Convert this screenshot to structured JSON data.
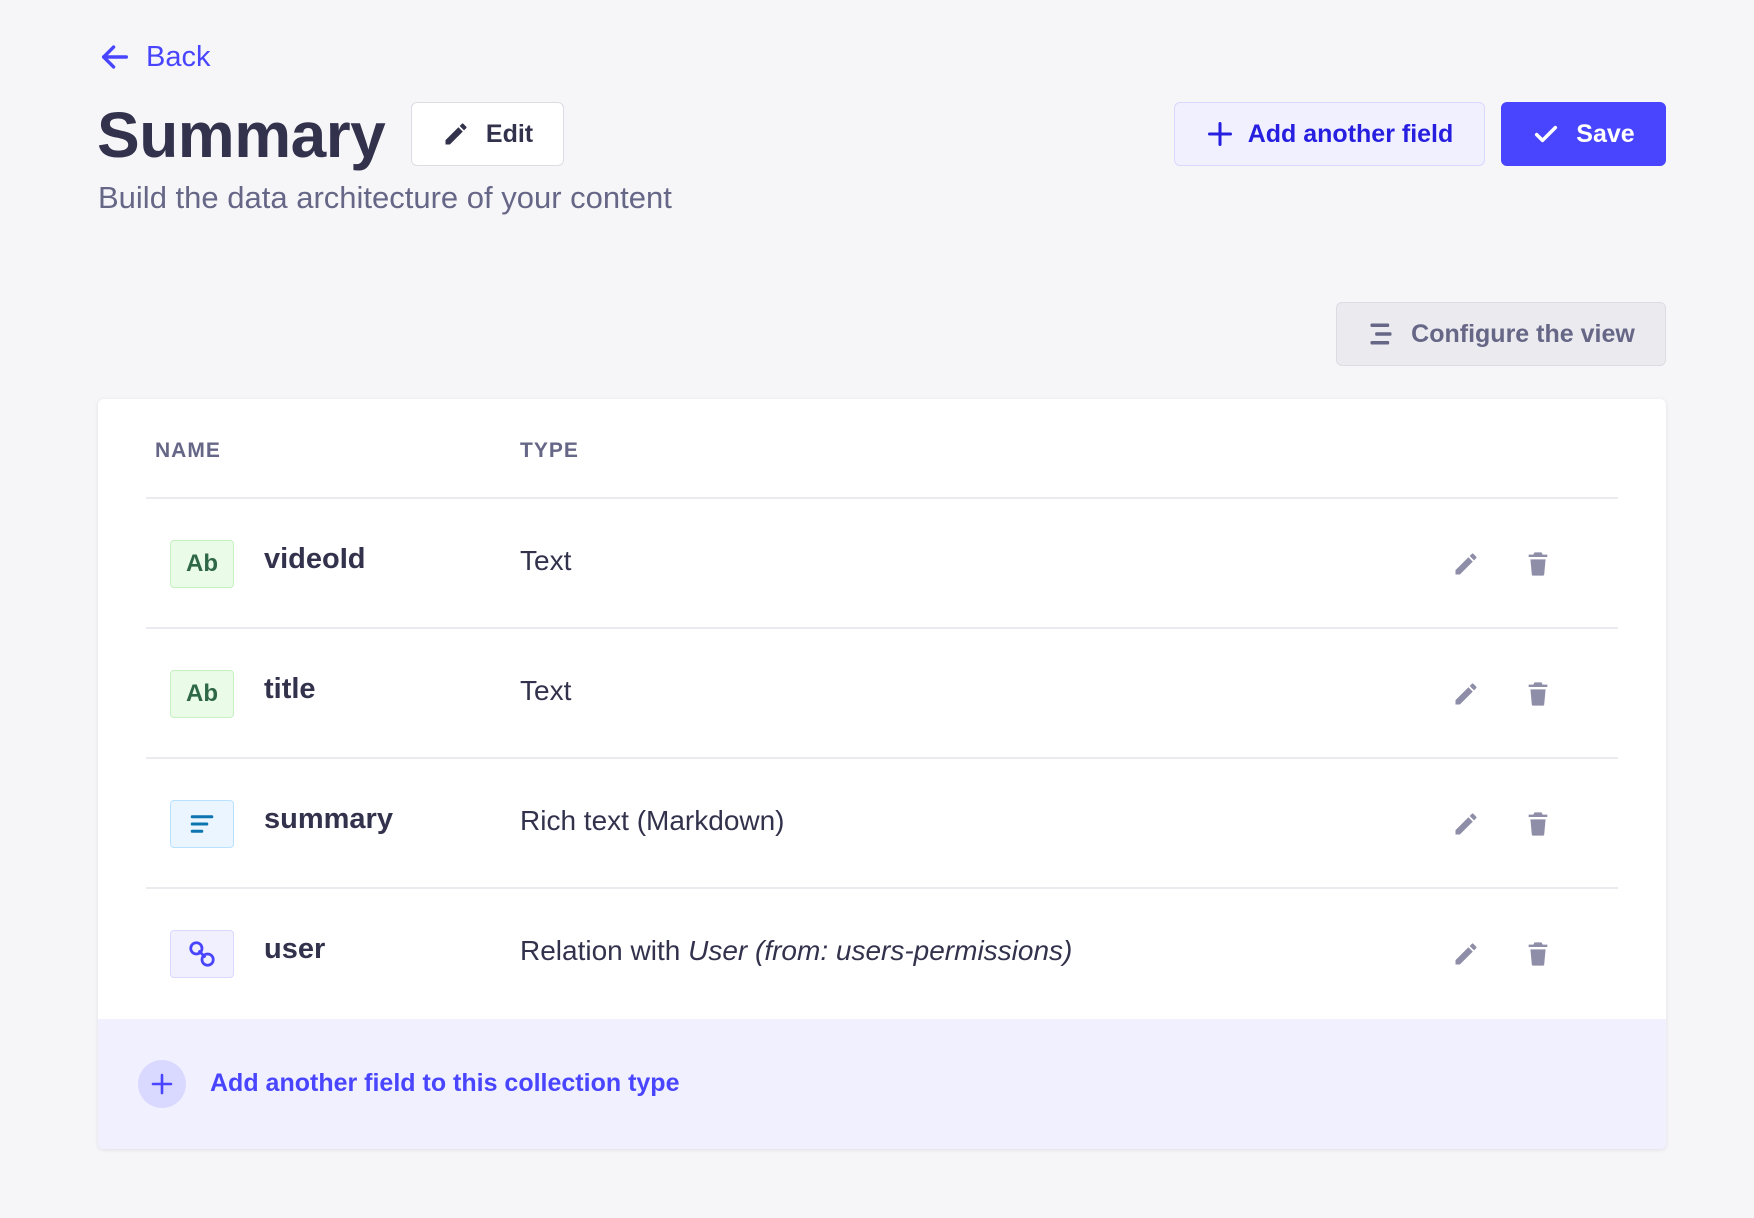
{
  "header": {
    "back_label": "Back",
    "title": "Summary",
    "edit_label": "Edit",
    "subtitle": "Build the data architecture of your content",
    "add_field_label": "Add another field",
    "save_label": "Save",
    "configure_label": "Configure the view"
  },
  "table": {
    "columns": [
      "NAME",
      "TYPE"
    ],
    "rows": [
      {
        "icon": "text-type-icon",
        "badge": "Ab",
        "name": "videoId",
        "type": "Text",
        "type_italic": ""
      },
      {
        "icon": "text-type-icon",
        "badge": "Ab",
        "name": "title",
        "type": "Text",
        "type_italic": ""
      },
      {
        "icon": "richtext-type-icon",
        "badge": "",
        "name": "summary",
        "type": "Rich text (Markdown)",
        "type_italic": ""
      },
      {
        "icon": "relation-type-icon",
        "badge": "",
        "name": "user",
        "type": "Relation with ",
        "type_italic": "User (from: users-permissions)"
      }
    ],
    "footer_label": "Add another field to this collection type"
  },
  "colors": {
    "primary": "#4945ff",
    "background": "#f6f6f9",
    "text_badge_bg": "#eafbe7",
    "richtext_badge_bg": "#eaf5ff",
    "relation_badge_bg": "#f0f0ff"
  }
}
